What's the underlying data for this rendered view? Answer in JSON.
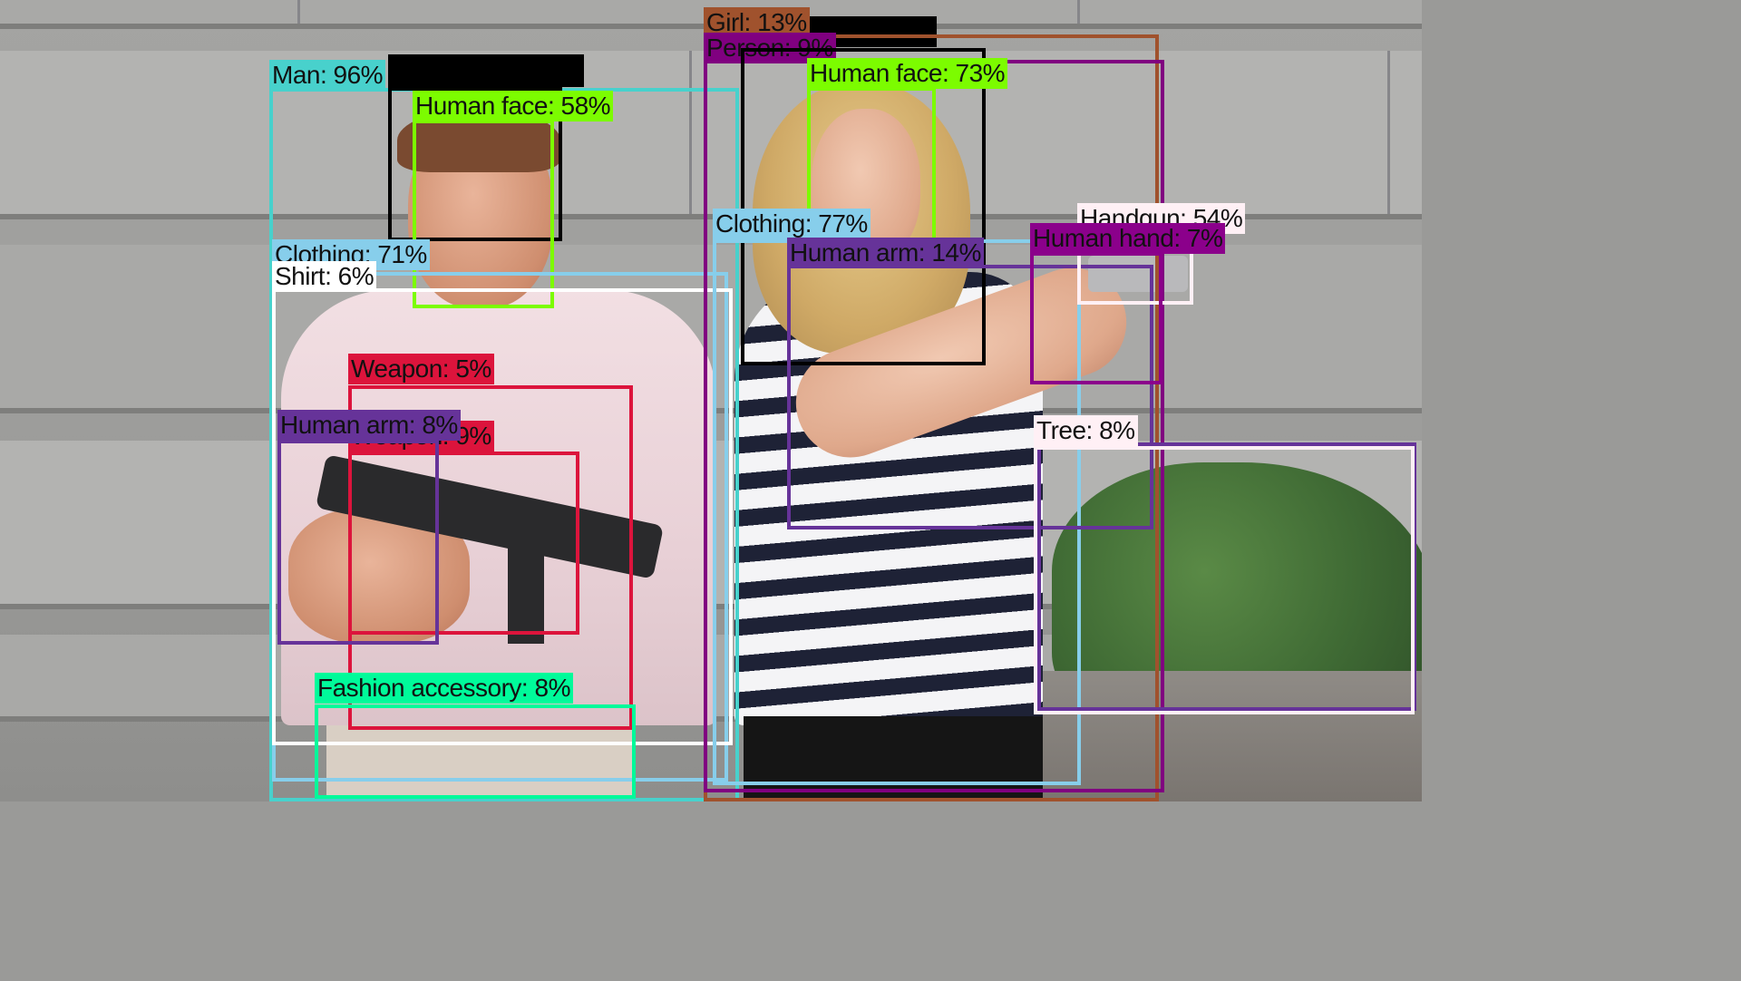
{
  "labels": {
    "man": "Man: 96%",
    "human_face_left": "Human face: 58%",
    "clothing_left": "Clothing: 71%",
    "shirt": "Shirt: 6%",
    "weapon_a": "Weapon: 5%",
    "human_arm_left": "Human arm: 8%",
    "weapon_b": "Weapon: 9%",
    "fashion_accessory": "Fashion accessory: 8%",
    "girl": "Girl: 13%",
    "person": "Person: 9%",
    "human_face_right": "Human face: 73%",
    "clothing_right": "Clothing: 77%",
    "human_arm_right": "Human arm: 14%",
    "handgun": "Handgun: 54%",
    "human_hand": "Human hand: 7%",
    "tree": "Tree: 8%"
  },
  "colors": {
    "man": "#48d1cc",
    "human_face": "#7cfc00",
    "clothing": "#87ceeb",
    "shirt": "#ffffff",
    "weapon": "#dc143c",
    "human_arm": "#663399",
    "fashion_accessory": "#00fa9a",
    "girl": "#a0522d",
    "person": "#800080",
    "handgun": "#fff0f5",
    "human_hand": "#8b008b",
    "tree": "#fff0f5",
    "tree_box": "#663399",
    "redaction": "#000000"
  }
}
